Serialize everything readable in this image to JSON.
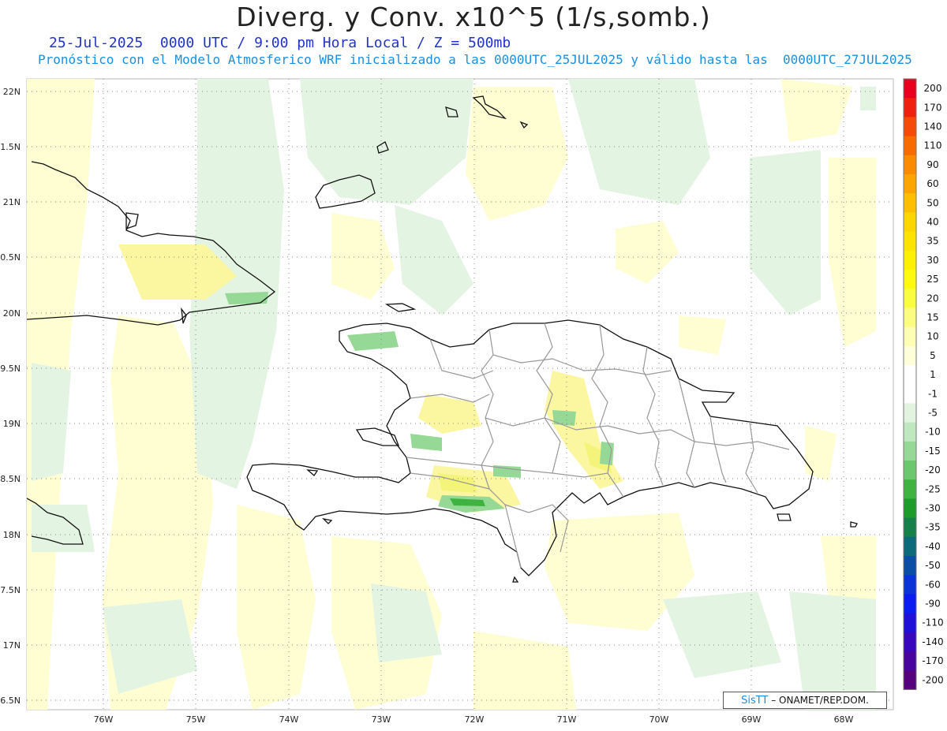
{
  "header": {
    "title": "Diverg. y Conv. x10^5 (1/s,somb.)",
    "subtitle1": "25-Jul-2025  0000 UTC / 9:00 pm Hora Local / Z = 500mb",
    "subtitle2": "Pronóstico con el Modelo Atmosferico WRF inicializado a las 0000UTC_25JUL2025 y válido hasta las  0000UTC_27JUL2025"
  },
  "map": {
    "lat_labels": [
      "22N",
      "1.5N",
      "21N",
      "0.5N",
      "20N",
      "9.5N",
      "19N",
      "8.5N",
      "18N",
      "7.5N",
      "17N",
      "6.5N"
    ],
    "lon_labels": [
      "76W",
      "75W",
      "74W",
      "73W",
      "72W",
      "71W",
      "70W",
      "69W",
      "68W"
    ],
    "colors": {
      "coast": "#111111",
      "provinces": "#999999",
      "grid": "#888888"
    }
  },
  "colorbar": {
    "labels": [
      "200",
      "170",
      "140",
      "110",
      "90",
      "60",
      "50",
      "40",
      "35",
      "30",
      "25",
      "20",
      "15",
      "10",
      "5",
      "1",
      "-1",
      "-5",
      "-10",
      "-15",
      "-20",
      "-25",
      "-30",
      "-35",
      "-40",
      "-50",
      "-60",
      "-90",
      "-110",
      "-140",
      "-170",
      "-200"
    ],
    "colors": [
      "#e8001e",
      "#f02010",
      "#f54a08",
      "#f86b00",
      "#fa8a00",
      "#fca500",
      "#fdbf00",
      "#fdd500",
      "#fde400",
      "#fdf000",
      "#fdfa10",
      "#fafc40",
      "#fcfc80",
      "#fdfdb4",
      "#fefed8",
      "#ffffff",
      "#ffffff",
      "#e2f4e0",
      "#bfe8bf",
      "#96d896",
      "#6cc86c",
      "#3fb33f",
      "#1e9c2a",
      "#15804a",
      "#0d6a7a",
      "#0b4ea6",
      "#0a34d8",
      "#0a1cf0",
      "#2010d8",
      "#3a08bc",
      "#4a049e",
      "#56007e"
    ]
  },
  "credit": {
    "sis": "SisTT",
    "org": "– ONAMET/REP.DOM."
  }
}
